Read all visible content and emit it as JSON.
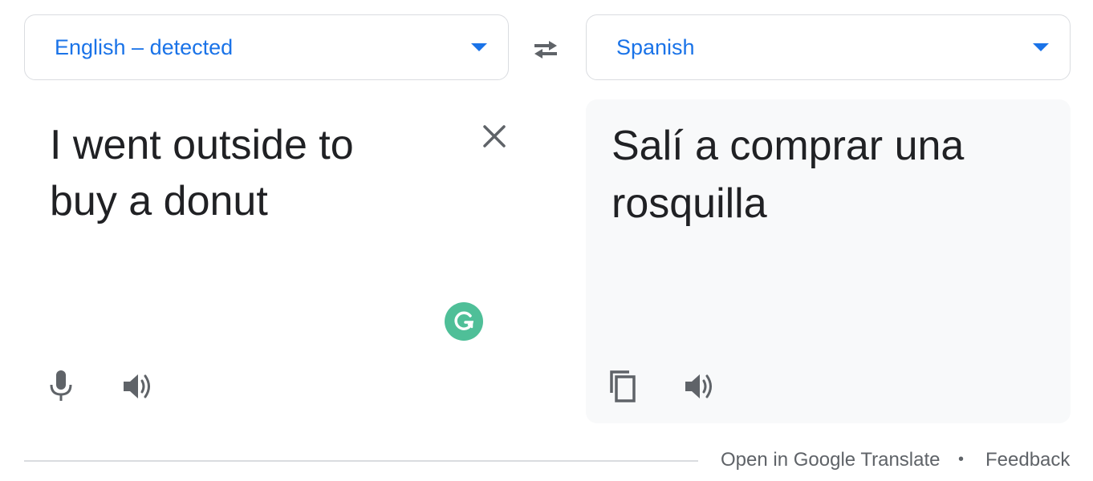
{
  "source": {
    "language_label": "English – detected",
    "text": "I went outside to\nbuy a donut"
  },
  "target": {
    "language_label": "Spanish",
    "text": "Salí a comprar una\nrosquilla"
  },
  "footer": {
    "open_link": "Open in Google Translate",
    "separator": "•",
    "feedback_link": "Feedback"
  },
  "colors": {
    "accent": "#1a73e8",
    "grammarly": "#4fbf98",
    "icon": "#5f6368",
    "target_bg": "#f8f9fa"
  },
  "icons": {
    "swap": "swap-arrows-icon",
    "clear": "close-icon",
    "mic": "microphone-icon",
    "speaker": "speaker-icon",
    "copy": "copy-icon",
    "grammarly": "grammarly-icon"
  }
}
